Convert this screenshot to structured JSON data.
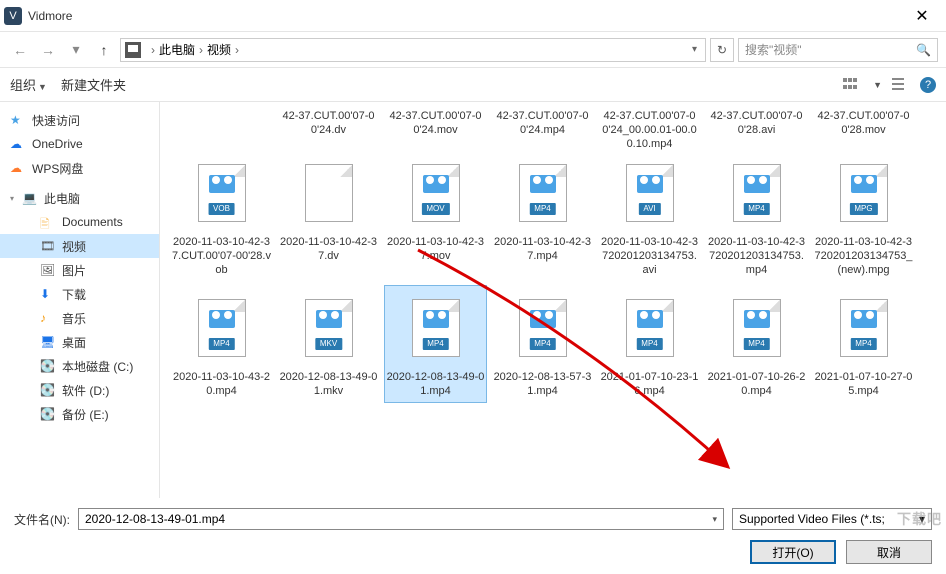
{
  "title": "Vidmore",
  "breadcrumb": {
    "pc": "此电脑",
    "loc": "视频"
  },
  "search": {
    "placeholder": "搜索\"视频\""
  },
  "toolbar": {
    "organize": "组织",
    "newfolder": "新建文件夹"
  },
  "sidebar": {
    "quick": "快速访问",
    "onedrive": "OneDrive",
    "wps": "WPS网盘",
    "pc": "此电脑",
    "documents": "Documents",
    "video": "视频",
    "pictures": "图片",
    "downloads": "下载",
    "music": "音乐",
    "desktop": "桌面",
    "cdrive": "本地磁盘 (C:)",
    "ddrive": "软件 (D:)",
    "edrive": "备份 (E:)"
  },
  "files_row0": [
    "42-37.CUT.00'07-00'24.dv",
    "42-37.CUT.00'07-00'24.mov",
    "42-37.CUT.00'07-00'24.mp4",
    "42-37.CUT.00'07-00'24_00.00.01-00.00.10.mp4",
    "42-37.CUT.00'07-00'28.avi",
    "42-37.CUT.00'07-00'28.mov"
  ],
  "files_row1": [
    {
      "name": "2020-11-03-10-42-37.CUT.00'07-00'28.vob",
      "ext": "VOB"
    },
    {
      "name": "2020-11-03-10-42-37.dv",
      "ext": ""
    },
    {
      "name": "2020-11-03-10-42-37.mov",
      "ext": "MOV"
    },
    {
      "name": "2020-11-03-10-42-37.mp4",
      "ext": "MP4"
    },
    {
      "name": "2020-11-03-10-42-3720201203134753.avi",
      "ext": "AVI"
    },
    {
      "name": "2020-11-03-10-42-3720201203134753.mp4",
      "ext": "MP4"
    },
    {
      "name": "2020-11-03-10-42-3720201203134753_(new).mpg",
      "ext": "MPG"
    }
  ],
  "files_row2": [
    {
      "name": "2020-11-03-10-43-20.mp4",
      "ext": "MP4",
      "sel": false
    },
    {
      "name": "2020-12-08-13-49-01.mkv",
      "ext": "MKV",
      "sel": false
    },
    {
      "name": "2020-12-08-13-49-01.mp4",
      "ext": "MP4",
      "sel": true
    },
    {
      "name": "2020-12-08-13-57-31.mp4",
      "ext": "MP4",
      "sel": false
    },
    {
      "name": "2021-01-07-10-23-16.mp4",
      "ext": "MP4",
      "sel": false
    },
    {
      "name": "2021-01-07-10-26-20.mp4",
      "ext": "MP4",
      "sel": false
    },
    {
      "name": "2021-01-07-10-27-05.mp4",
      "ext": "MP4",
      "sel": false
    }
  ],
  "footer": {
    "label": "文件名(N):",
    "value": "2020-12-08-13-49-01.mp4",
    "filter": "Supported Video Files (*.ts; ",
    "open": "打开(O)",
    "cancel": "取消"
  },
  "watermark": "下载吧"
}
